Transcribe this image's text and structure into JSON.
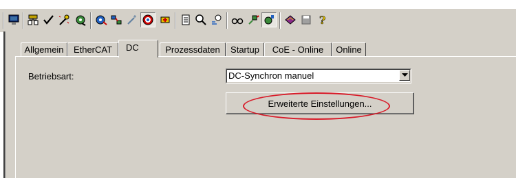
{
  "toolbar": {
    "icons": [
      "monitor-icon",
      "network-icon",
      "check-icon",
      "wizard-icon",
      "gear-icon",
      "gear-arrow-icon",
      "network-scan-icon",
      "wand-icon",
      "target-icon",
      "add-icon",
      "document-icon",
      "search-icon",
      "find-replace-icon",
      "glasses-icon",
      "plug-icon",
      "device-icon",
      "book-icon",
      "disk-icon",
      "help-icon"
    ]
  },
  "tabs": [
    {
      "label": "Allgemein"
    },
    {
      "label": "EtherCAT"
    },
    {
      "label": "DC"
    },
    {
      "label": "Prozessdaten"
    },
    {
      "label": "Startup"
    },
    {
      "label": "CoE - Online"
    },
    {
      "label": "Online"
    }
  ],
  "dc": {
    "mode_label": "Betriebsart:",
    "mode_value": "DC-Synchron manuel",
    "advanced_button": "Erweiterte Einstellungen..."
  },
  "colors": {
    "face": "#d4d0c8",
    "highlight": "#d81c2a"
  }
}
